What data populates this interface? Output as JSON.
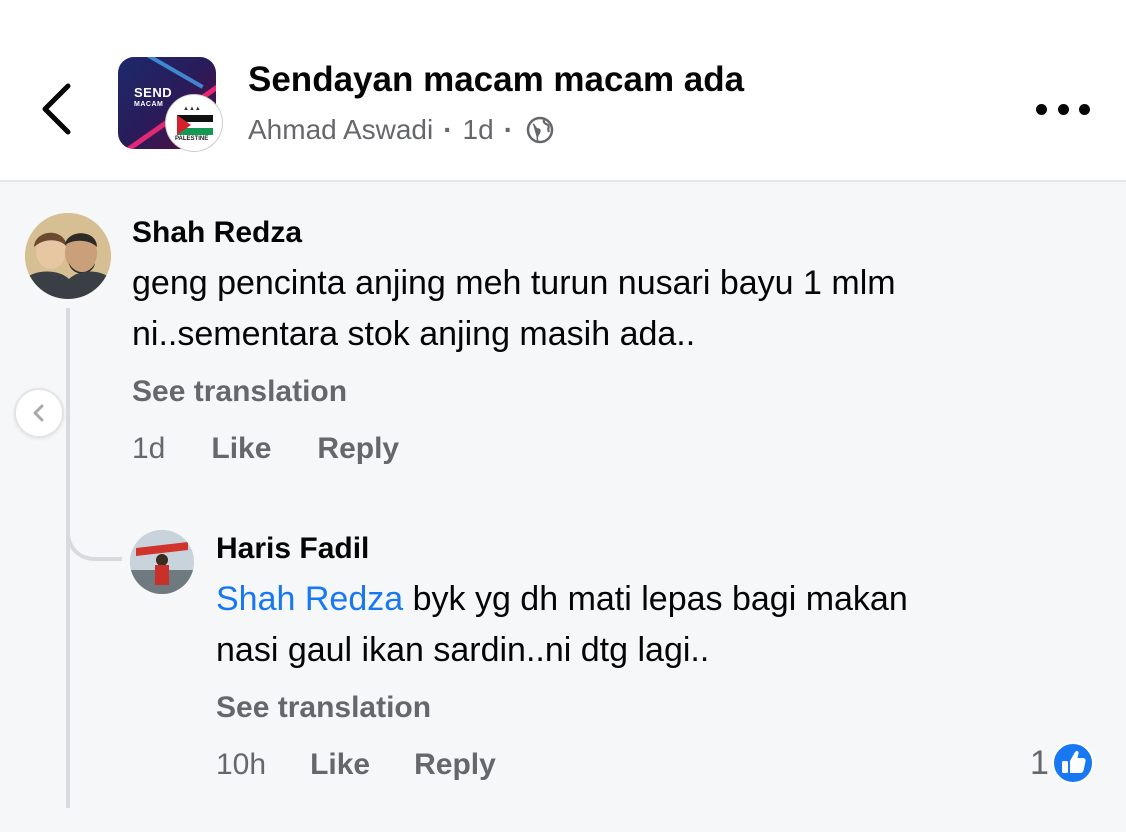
{
  "header": {
    "title": "Sendayan macam macam ada",
    "author": "Ahmad Aswadi",
    "separator": "·",
    "time": "1d",
    "visibility_icon": "globe-icon",
    "back_icon": "chevron-left-icon",
    "more_icon": "more-horizontal-icon",
    "group_avatar_text_line1": "SEND",
    "group_avatar_text_line2": "MACAM",
    "page_avatar_text": "PALESTINE"
  },
  "comments": [
    {
      "author": "Shah Redza",
      "lines": [
        "geng pencinta anjing meh turun nusari bayu 1 mlm",
        "ni..sementara stok anjing masih ada.."
      ],
      "see_translation": "See translation",
      "time": "1d",
      "like_label": "Like",
      "reply_label": "Reply"
    },
    {
      "author": "Haris Fadil",
      "mention": "Shah Redza",
      "line1_rest": " byk yg dh mati lepas bagi makan",
      "line2": "nasi gaul ikan sardin..ni dtg lagi..",
      "see_translation": "See translation",
      "time": "10h",
      "like_label": "Like",
      "reply_label": "Reply",
      "reaction_count": "1",
      "reaction_icon": "like-thumb-icon"
    }
  ],
  "colors": {
    "accent": "#1877f2",
    "secondary_text": "#65676b",
    "primary_text": "#050505"
  }
}
